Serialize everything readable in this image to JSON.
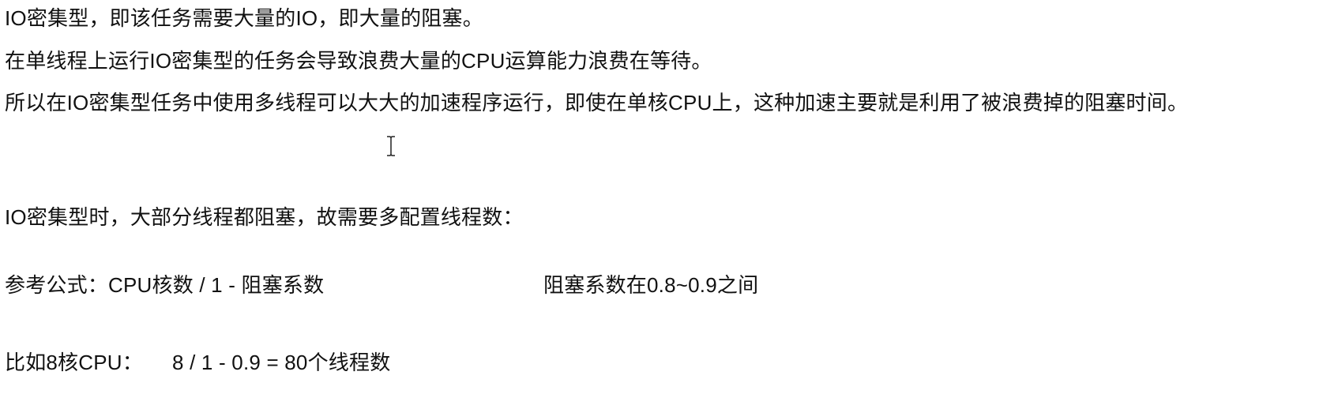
{
  "document": {
    "line1": "IO密集型，即该任务需要大量的IO，即大量的阻塞。",
    "line2": "在单线程上运行IO密集型的任务会导致浪费大量的CPU运算能力浪费在等待。",
    "line3": "所以在IO密集型任务中使用多线程可以大大的加速程序运行，即使在单核CPU上，这种加速主要就是利用了被浪费掉的阻塞时间。",
    "line4": "IO密集型时，大部分线程都阻塞，故需要多配置线程数：",
    "formula": {
      "left": "参考公式：CPU核数 / 1 - 阻塞系数",
      "right": "阻塞系数在0.8~0.9之间"
    },
    "example": {
      "label": "比如8核CPU：",
      "value": "8 / 1 - 0.9 = 80个线程数"
    }
  },
  "cursor": {
    "icon": "text-cursor-icon"
  }
}
